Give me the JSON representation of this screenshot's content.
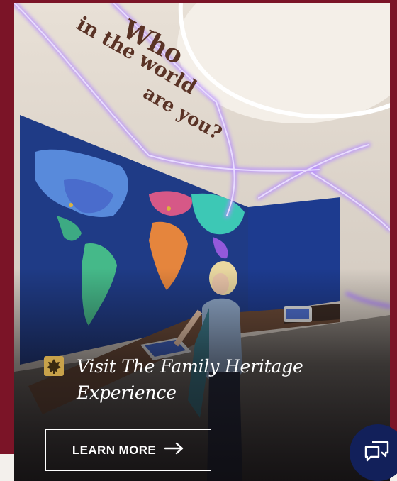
{
  "scene": {
    "sign_lines": [
      "Who",
      "in the world",
      "are you?"
    ]
  },
  "promo": {
    "headline_line1": "Visit The Family Heritage",
    "headline_line2": "Experience",
    "badge_icon": "leaf-icon",
    "cta_label": "LEARN MORE",
    "cta_icon": "arrow-right-icon"
  },
  "chat": {
    "icon": "chat-bubbles-icon"
  },
  "colors": {
    "page_background": "#7b1427",
    "badge": "#c8a24a",
    "chat_button": "#12205a",
    "neon": "#a06cff"
  }
}
